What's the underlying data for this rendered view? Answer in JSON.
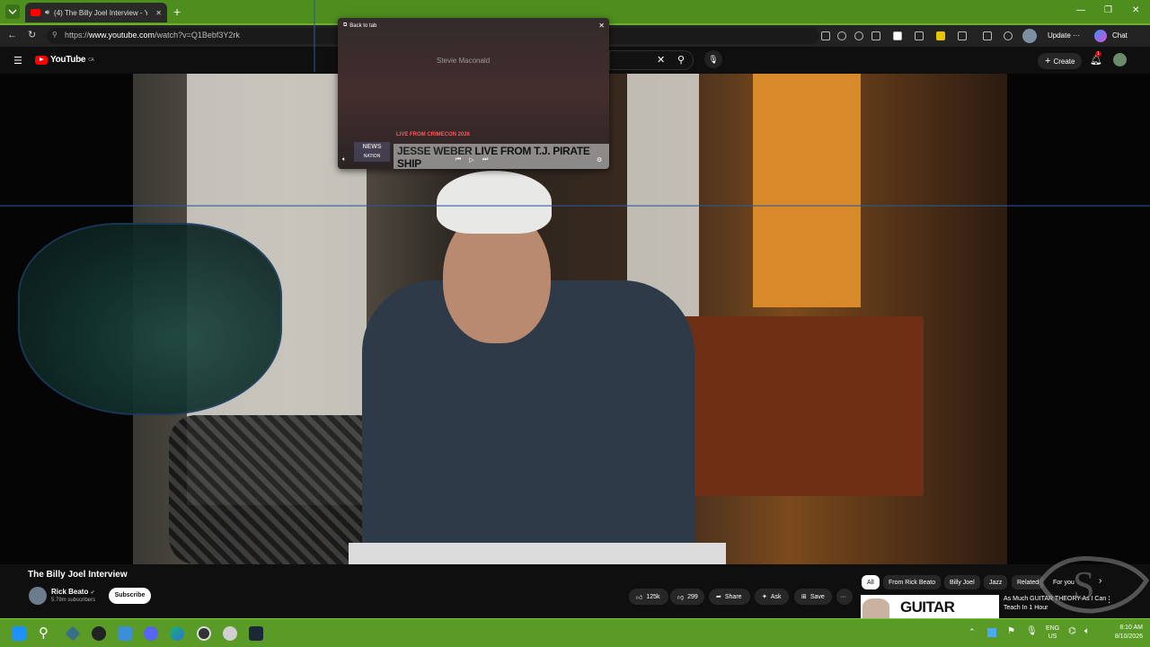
{
  "browser": {
    "tab_title": "(4) The Billy Joel Interview - Yo",
    "url_prefix": "https://",
    "url_host": "www.youtube.com",
    "url_path": "/watch?v=Q1Bebf3Y2rk",
    "update_label": "Update",
    "chat_label": "Chat"
  },
  "youtube": {
    "logo_text": "YouTube",
    "country": "CA",
    "create_label": "Create",
    "notification_count": "1"
  },
  "mini_player": {
    "back_label": "Back to tab",
    "person_name": "Stevie Maconald",
    "live_label": "LIVE FROM CRIMECON 2026",
    "logo_line1": "NEWS",
    "logo_line2": "NATION",
    "headline_bold": "JESSE WEBER",
    "headline_rest": " LIVE FROM T.J. PIRATE SHIP"
  },
  "video": {
    "title": "The Billy Joel Interview",
    "channel": "Rick Beato",
    "subscribers": "5.79m subscribers",
    "subscribe_label": "Subscribe",
    "likes": "125k",
    "dislikes": "299",
    "share_label": "Share",
    "ask_label": "Ask",
    "save_label": "Save"
  },
  "chips": [
    "All",
    "From Rick Beato",
    "Billy Joel",
    "Jazz",
    "Related",
    "For you"
  ],
  "recommended": {
    "thumb_text": "GUITAR THEORY",
    "title": "As Much GUITAR THEORY As I Can Teach In 1 Hour"
  },
  "taskbar": {
    "lang_line1": "ENG",
    "lang_line2": "US",
    "time": "8:10 AM",
    "date": "8/10/2026"
  }
}
